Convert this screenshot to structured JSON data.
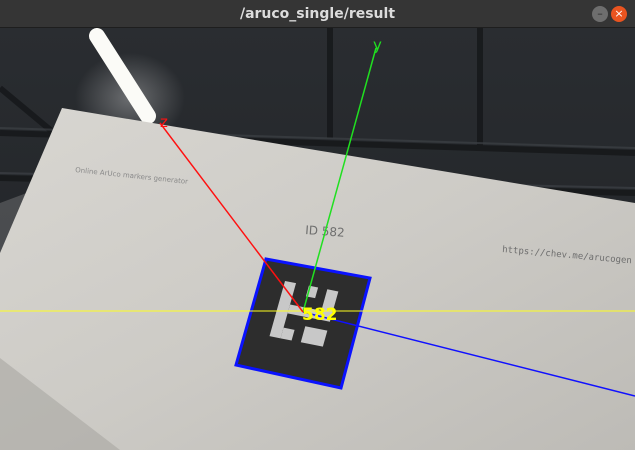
{
  "window": {
    "title": "/aruco_single/result",
    "minimize_glyph": "–",
    "close_glyph": "×"
  },
  "image": {
    "paper_header_text": "Online ArUco markers generator",
    "paper_id_text": "ID 582",
    "paper_url_text": "https://chev.me/arucogen",
    "marker_label": "582",
    "axis_labels": {
      "x": "",
      "y": "y",
      "z": "z"
    },
    "colors": {
      "x_axis": "#1010ff",
      "y_axis": "#20e020",
      "z_axis": "#ff1010",
      "marker_border": "#0a12ff",
      "horizon_line": "#ffff20",
      "marker_label": "#ffff00"
    }
  }
}
